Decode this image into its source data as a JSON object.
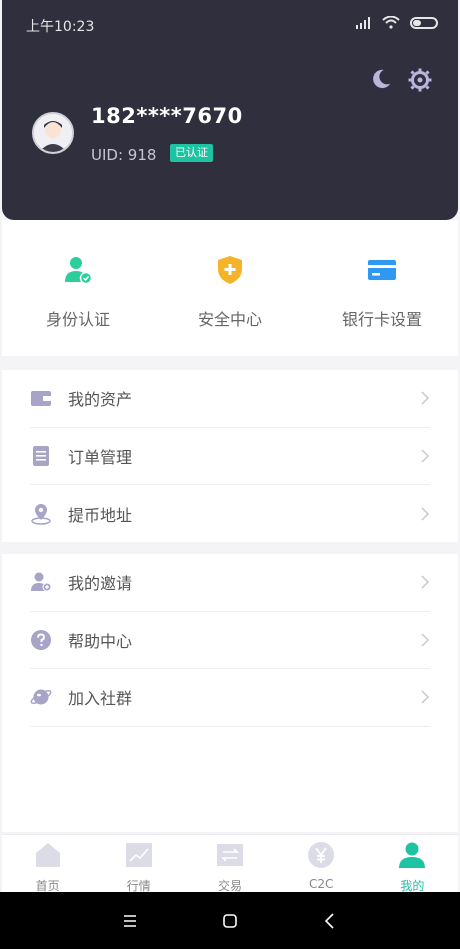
{
  "status_bar": {
    "time": "上午10:23"
  },
  "profile": {
    "phone": "182****7670",
    "uid": "UID: 918",
    "verified": "已认证"
  },
  "quick_actions": [
    {
      "label": "身份认证",
      "icon": "identity-verify-icon"
    },
    {
      "label": "安全中心",
      "icon": "security-shield-icon"
    },
    {
      "label": "银行卡设置",
      "icon": "bank-card-icon"
    }
  ],
  "menu_group1": [
    {
      "label": "我的资产",
      "icon": "wallet-icon"
    },
    {
      "label": "订单管理",
      "icon": "clipboard-icon"
    },
    {
      "label": "提币地址",
      "icon": "location-pin-icon"
    }
  ],
  "menu_group2": [
    {
      "label": "我的邀请",
      "icon": "invite-user-icon"
    },
    {
      "label": "帮助中心",
      "icon": "help-icon"
    },
    {
      "label": "加入社群",
      "icon": "planet-icon"
    }
  ],
  "tabbar": [
    {
      "label": "首页",
      "icon": "home-icon"
    },
    {
      "label": "行情",
      "icon": "chart-icon"
    },
    {
      "label": "交易",
      "icon": "exchange-icon"
    },
    {
      "label": "C2C",
      "icon": "yen-icon"
    },
    {
      "label": "我的",
      "icon": "profile-icon",
      "active": true
    }
  ],
  "colors": {
    "accent": "#1ec3a2",
    "header_bg": "#2f2f3d",
    "icon_purple": "#a7a4c8"
  }
}
